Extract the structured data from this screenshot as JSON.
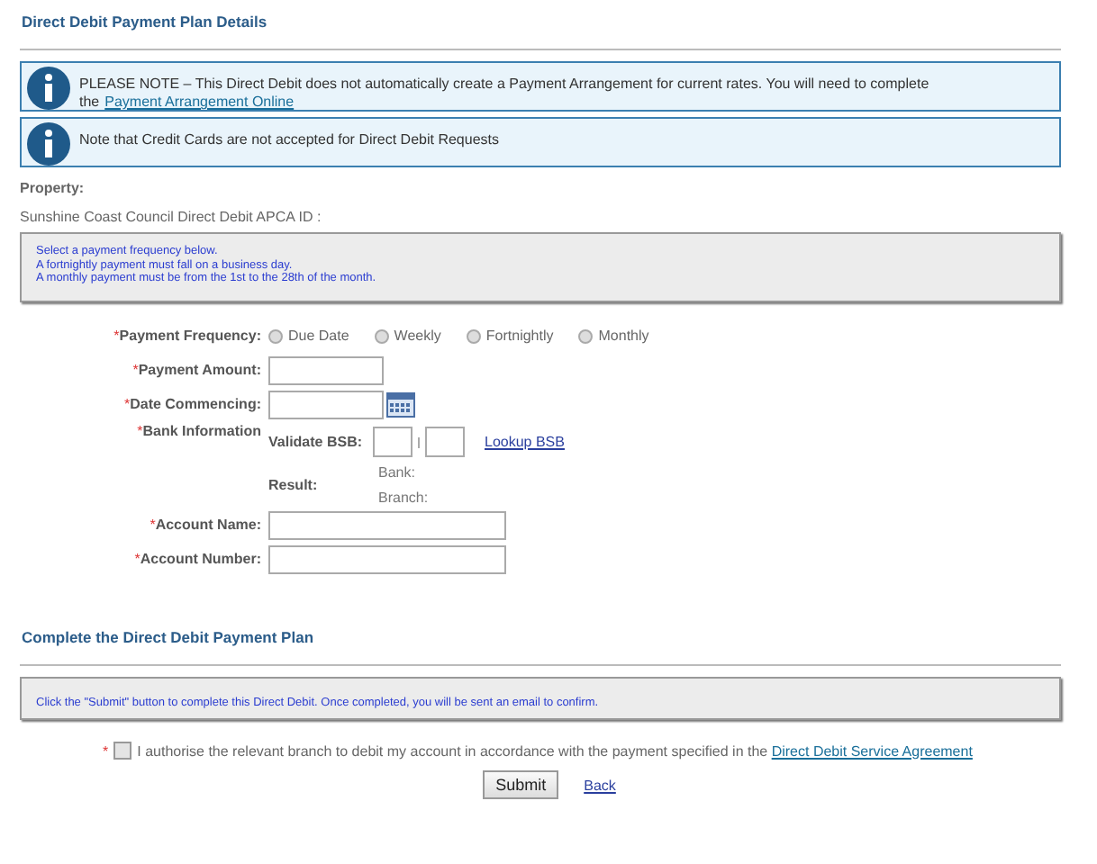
{
  "heading": "Direct Debit Payment Plan Details",
  "notices": [
    {
      "text": "PLEASE NOTE – This Direct Debit does not automatically create a Payment Arrangement for current rates. You will need to complete the",
      "link": "Payment Arrangement Online"
    },
    {
      "text": "Note that Credit Cards are not accepted for Direct Debit Requests"
    }
  ],
  "property_label": "Property:",
  "apca_label": "Sunshine Coast Council Direct Debit APCA ID :",
  "instructions": [
    "Select a payment frequency below.",
    "A fortnightly payment must fall on a business day.",
    "A monthly payment must be from the 1st to the 28th of the month."
  ],
  "form": {
    "frequency": {
      "mark": "*",
      "label": "Payment Frequency:",
      "options": [
        {
          "label": "Due Date",
          "selected": false
        },
        {
          "label": "Weekly",
          "selected": false
        },
        {
          "label": "Fortnightly",
          "selected": false
        },
        {
          "label": "Monthly",
          "selected": false
        }
      ]
    },
    "amount_mark": "*",
    "amount_label": "Payment Amount:",
    "date_mark": "*",
    "date_label": "Date Commencing:",
    "bank": {
      "mark": "*",
      "label": "Bank Information",
      "validate_label": "Validate BSB:",
      "lookup_link": "Lookup BSB",
      "result_label": "Result:",
      "bank_label": "Bank:",
      "branch_label": "Branch:"
    },
    "account_name_mark": "*",
    "account_name_label": "Account Name:",
    "account_number_mark": "*",
    "account_number_label": "Account Number:"
  },
  "complete_heading": "Complete the Direct Debit Payment Plan",
  "complete_note": "Click the \"Submit\" button to complete this Direct Debit. Once completed, you will be sent an email to confirm.",
  "authorise": {
    "mark": "*",
    "checked": false,
    "text": "I authorise the relevant branch to debit my account in accordance with the payment specified in the",
    "link": "Direct Debit Service Agreement"
  },
  "submit": "Submit",
  "back": "Back"
}
